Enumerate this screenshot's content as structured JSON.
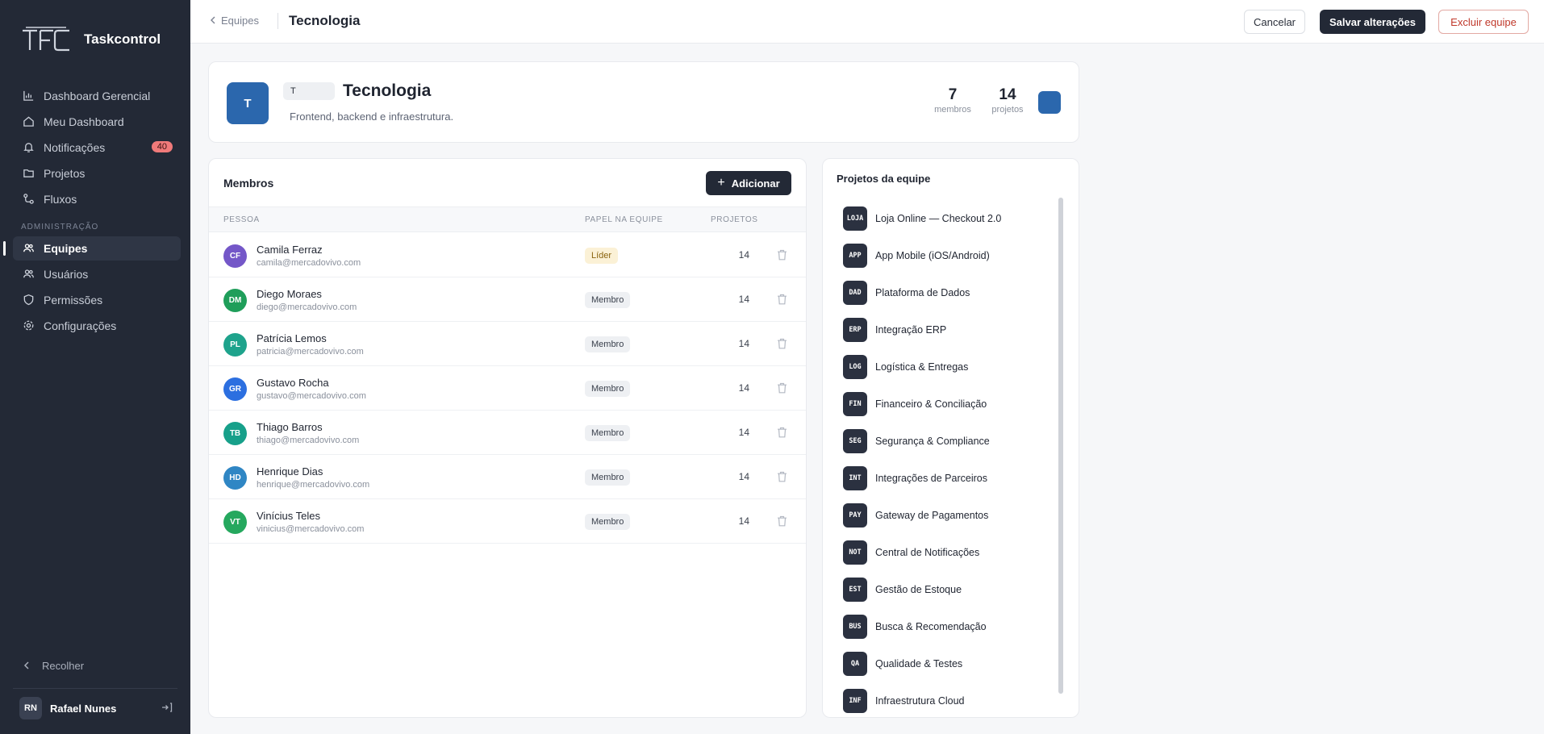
{
  "brand": {
    "name": "Taskcontrol"
  },
  "sidebar": {
    "items": [
      {
        "label": "Dashboard Gerencial",
        "icon": "chart-icon"
      },
      {
        "label": "Meu Dashboard",
        "icon": "home-icon"
      },
      {
        "label": "Notificações",
        "icon": "bell-icon",
        "badge": "40"
      },
      {
        "label": "Projetos",
        "icon": "folder-icon"
      },
      {
        "label": "Fluxos",
        "icon": "flow-icon"
      }
    ],
    "section_label": "ADMINISTRAÇÃO",
    "admin_items": [
      {
        "label": "Equipes",
        "icon": "users-icon",
        "active": true
      },
      {
        "label": "Usuários",
        "icon": "user-icon"
      },
      {
        "label": "Permissões",
        "icon": "shield-icon"
      },
      {
        "label": "Configurações",
        "icon": "gear-icon"
      }
    ],
    "collapse_label": "Recolher",
    "user": {
      "initials": "RN",
      "name": "Rafael Nunes"
    }
  },
  "topbar": {
    "breadcrumb": "Equipes",
    "title": "Tecnologia",
    "cancel_label": "Cancelar",
    "save_label": "Salvar alterações",
    "delete_label": "Excluir equipe"
  },
  "team": {
    "avatar_initial": "T",
    "initial_value": "T",
    "name": "Tecnologia",
    "description": "Frontend, backend e infraestrutura.",
    "members_count": "7",
    "members_label": "membros",
    "projects_count": "14",
    "projects_label": "projetos",
    "color": "#2b67ad"
  },
  "members": {
    "title": "Membros",
    "add_label": "Adicionar",
    "columns": {
      "person": "PESSOA",
      "role": "PAPEL NA EQUIPE",
      "projects": "PROJETOS"
    },
    "rows": [
      {
        "initials": "CF",
        "name": "Camila Ferraz",
        "email": "camila@mercadovivo.com",
        "role": "Líder",
        "projects": "14",
        "color": "#7457c8"
      },
      {
        "initials": "DM",
        "name": "Diego Moraes",
        "email": "diego@mercadovivo.com",
        "role": "Membro",
        "projects": "14",
        "color": "#1f9e5a"
      },
      {
        "initials": "PL",
        "name": "Patrícia Lemos",
        "email": "patricia@mercadovivo.com",
        "role": "Membro",
        "projects": "14",
        "color": "#1ea38c"
      },
      {
        "initials": "GR",
        "name": "Gustavo Rocha",
        "email": "gustavo@mercadovivo.com",
        "role": "Membro",
        "projects": "14",
        "color": "#2c6fe0"
      },
      {
        "initials": "TB",
        "name": "Thiago Barros",
        "email": "thiago@mercadovivo.com",
        "role": "Membro",
        "projects": "14",
        "color": "#17a08a"
      },
      {
        "initials": "HD",
        "name": "Henrique Dias",
        "email": "henrique@mercadovivo.com",
        "role": "Membro",
        "projects": "14",
        "color": "#2f86c4"
      },
      {
        "initials": "VT",
        "name": "Vinícius Teles",
        "email": "vinicius@mercadovivo.com",
        "role": "Membro",
        "projects": "14",
        "color": "#25a85e"
      }
    ]
  },
  "projects": {
    "title": "Projetos da equipe",
    "items": [
      {
        "code": "LOJA",
        "name": "Loja Online — Checkout 2.0"
      },
      {
        "code": "APP",
        "name": "App Mobile (iOS/Android)"
      },
      {
        "code": "DAD",
        "name": "Plataforma de Dados"
      },
      {
        "code": "ERP",
        "name": "Integração ERP"
      },
      {
        "code": "LOG",
        "name": "Logística & Entregas"
      },
      {
        "code": "FIN",
        "name": "Financeiro & Conciliação"
      },
      {
        "code": "SEG",
        "name": "Segurança & Compliance"
      },
      {
        "code": "INT",
        "name": "Integrações de Parceiros"
      },
      {
        "code": "PAY",
        "name": "Gateway de Pagamentos"
      },
      {
        "code": "NOT",
        "name": "Central de Notificações"
      },
      {
        "code": "EST",
        "name": "Gestão de Estoque"
      },
      {
        "code": "BUS",
        "name": "Busca & Recomendação"
      },
      {
        "code": "QA",
        "name": "Qualidade & Testes"
      },
      {
        "code": "INF",
        "name": "Infraestrutura Cloud"
      }
    ]
  }
}
